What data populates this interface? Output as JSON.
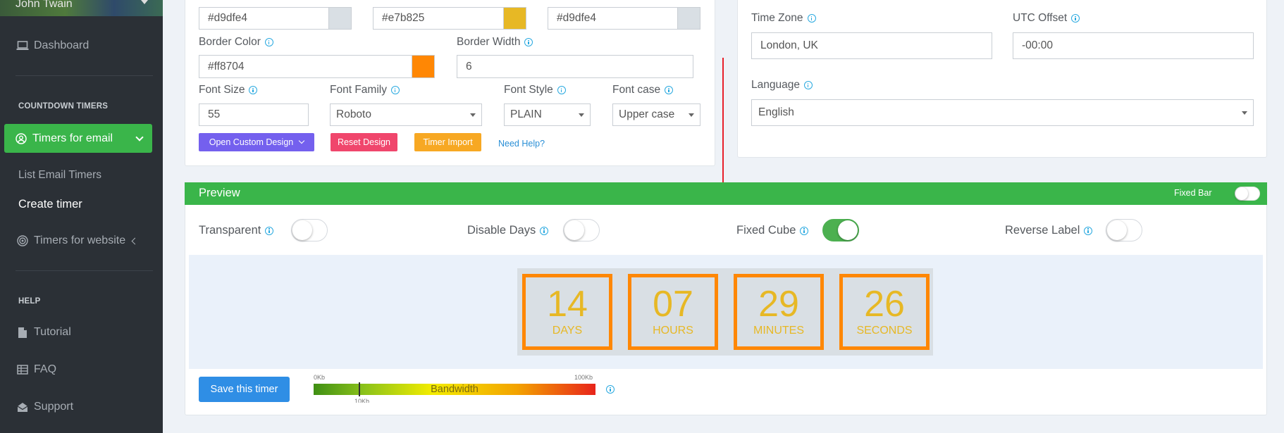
{
  "sidebar": {
    "user_name": "John Twain",
    "items": [
      {
        "label": "Dashboard",
        "icon": "laptop-icon"
      }
    ],
    "section_countdown": "COUNTDOWN TIMERS",
    "active_item": "Timers for email",
    "sub_items": [
      "List Email Timers",
      "Create timer"
    ],
    "website_item": "Timers for website",
    "section_help": "HELP",
    "help_items": [
      "Tutorial",
      "FAQ",
      "Support"
    ]
  },
  "design": {
    "color_values": [
      "#d9dfe4",
      "#e7b825",
      "#d9dfe4"
    ],
    "border_color_label": "Border Color",
    "border_color_value": "#ff8704",
    "border_width_label": "Border Width",
    "border_width_value": "6",
    "font_size_label": "Font Size",
    "font_size_value": "55",
    "font_family_label": "Font Family",
    "font_family_value": "Roboto",
    "font_style_label": "Font Style",
    "font_style_value": "PLAIN",
    "font_case_label": "Font case",
    "font_case_value": "Upper case",
    "btn_custom": "Open Custom Design",
    "btn_reset": "Reset Design",
    "btn_import": "Timer Import",
    "need_help": "Need Help?"
  },
  "settings": {
    "timezone_label": "Time Zone",
    "timezone_value": "London, UK",
    "utc_label": "UTC Offset",
    "utc_value": "-00:00",
    "language_label": "Language",
    "language_value": "English"
  },
  "preview": {
    "title": "Preview",
    "fixed_bar_label": "Fixed Bar",
    "fixed_bar_on": false,
    "toggles": [
      {
        "label": "Transparent",
        "on": false
      },
      {
        "label": "Disable Days",
        "on": false
      },
      {
        "label": "Fixed Cube",
        "on": true
      },
      {
        "label": "Reverse Label",
        "on": false
      }
    ],
    "timer": [
      {
        "value": "14",
        "unit": "DAYS"
      },
      {
        "value": "07",
        "unit": "HOURS"
      },
      {
        "value": "29",
        "unit": "MINUTES"
      },
      {
        "value": "26",
        "unit": "SECONDS"
      }
    ],
    "save_button": "Save this timer",
    "bandwidth_label": "Bandwidth",
    "bandwidth_min": "0Kb",
    "bandwidth_max": "100Kb",
    "bandwidth_marker": "10Kb",
    "bandwidth_level": 0.16
  },
  "colors": {
    "sidebar_bg": "#2b3036",
    "accent_green": "#3ab54a",
    "border_color": "#ff8704",
    "digit_color": "#e7b825",
    "cube_bg": "#d9dfe4",
    "btn_purple": "#7460ee",
    "btn_red": "#f0466c",
    "btn_orange": "#f7a823",
    "btn_blue": "#2f8ee5"
  }
}
